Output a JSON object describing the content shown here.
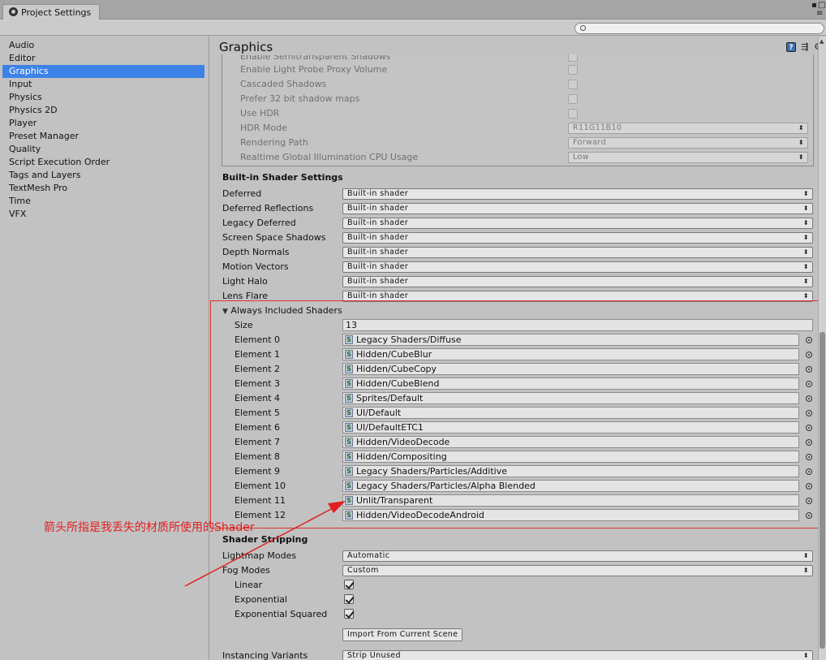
{
  "window": {
    "tab_title": "Project Settings",
    "controls": [
      "▪",
      "□",
      "≡"
    ]
  },
  "search": {
    "placeholder": ""
  },
  "sidebar": {
    "items": [
      {
        "label": "Audio"
      },
      {
        "label": "Editor"
      },
      {
        "label": "Graphics",
        "selected": true
      },
      {
        "label": "Input"
      },
      {
        "label": "Physics"
      },
      {
        "label": "Physics 2D"
      },
      {
        "label": "Player"
      },
      {
        "label": "Preset Manager"
      },
      {
        "label": "Quality"
      },
      {
        "label": "Script Execution Order"
      },
      {
        "label": "Tags and Layers"
      },
      {
        "label": "TextMesh Pro"
      },
      {
        "label": "Time"
      },
      {
        "label": "VFX"
      }
    ]
  },
  "header": {
    "title": "Graphics",
    "help_icon_label": "?"
  },
  "tier_settings": {
    "rows": [
      {
        "label": "Enable Semitransparent Shadows",
        "type": "check",
        "checked": false
      },
      {
        "label": "Enable Light Probe Proxy Volume",
        "type": "check",
        "checked": false
      },
      {
        "label": "Cascaded Shadows",
        "type": "check",
        "checked": false
      },
      {
        "label": "Prefer 32 bit shadow maps",
        "type": "check",
        "checked": false
      },
      {
        "label": "Use HDR",
        "type": "check",
        "checked": false
      },
      {
        "label": "HDR Mode",
        "type": "select",
        "value": "R11G11B10"
      },
      {
        "label": "Rendering Path",
        "type": "select",
        "value": "Forward"
      },
      {
        "label": "Realtime Global Illumination CPU Usage",
        "type": "select",
        "value": "Low"
      }
    ]
  },
  "builtin": {
    "title": "Built-in Shader Settings",
    "rows": [
      {
        "label": "Deferred",
        "value": "Built-in shader"
      },
      {
        "label": "Deferred Reflections",
        "value": "Built-in shader"
      },
      {
        "label": "Legacy Deferred",
        "value": "Built-in shader"
      },
      {
        "label": "Screen Space Shadows",
        "value": "Built-in shader"
      },
      {
        "label": "Depth Normals",
        "value": "Built-in shader"
      },
      {
        "label": "Motion Vectors",
        "value": "Built-in shader"
      },
      {
        "label": "Light Halo",
        "value": "Built-in shader"
      },
      {
        "label": "Lens Flare",
        "value": "Built-in shader"
      }
    ]
  },
  "always_included": {
    "title": "Always Included Shaders",
    "foldout_icon": "▼",
    "size_label": "Size",
    "size_value": "13",
    "elements": [
      {
        "label": "Element 0",
        "value": "Legacy Shaders/Diffuse"
      },
      {
        "label": "Element 1",
        "value": "Hidden/CubeBlur"
      },
      {
        "label": "Element 2",
        "value": "Hidden/CubeCopy"
      },
      {
        "label": "Element 3",
        "value": "Hidden/CubeBlend"
      },
      {
        "label": "Element 4",
        "value": "Sprites/Default"
      },
      {
        "label": "Element 5",
        "value": "UI/Default"
      },
      {
        "label": "Element 6",
        "value": "UI/DefaultETC1"
      },
      {
        "label": "Element 7",
        "value": "Hidden/VideoDecode"
      },
      {
        "label": "Element 8",
        "value": "Hidden/Compositing"
      },
      {
        "label": "Element 9",
        "value": "Legacy Shaders/Particles/Additive"
      },
      {
        "label": "Element 10",
        "value": "Legacy Shaders/Particles/Alpha Blended"
      },
      {
        "label": "Element 11",
        "value": "Unlit/Transparent"
      },
      {
        "label": "Element 12",
        "value": "Hidden/VideoDecodeAndroid"
      }
    ]
  },
  "stripping": {
    "title": "Shader Stripping",
    "lightmap_modes_label": "Lightmap Modes",
    "lightmap_modes_value": "Automatic",
    "fog_modes_label": "Fog Modes",
    "fog_modes_value": "Custom",
    "fog_options": [
      {
        "label": "Linear",
        "checked": true
      },
      {
        "label": "Exponential",
        "checked": true
      },
      {
        "label": "Exponential Squared",
        "checked": true
      }
    ],
    "import_button": "Import From Current Scene",
    "instancing_label": "Instancing Variants",
    "instancing_value": "Strip Unused"
  },
  "annotation": {
    "text": "箭头所指是我丢失的材质所使用的Shader",
    "color": "#e02020"
  },
  "colors": {
    "selection": "#3d82e6",
    "panel": "#c2c2c2",
    "annotation_red": "#e03030"
  }
}
